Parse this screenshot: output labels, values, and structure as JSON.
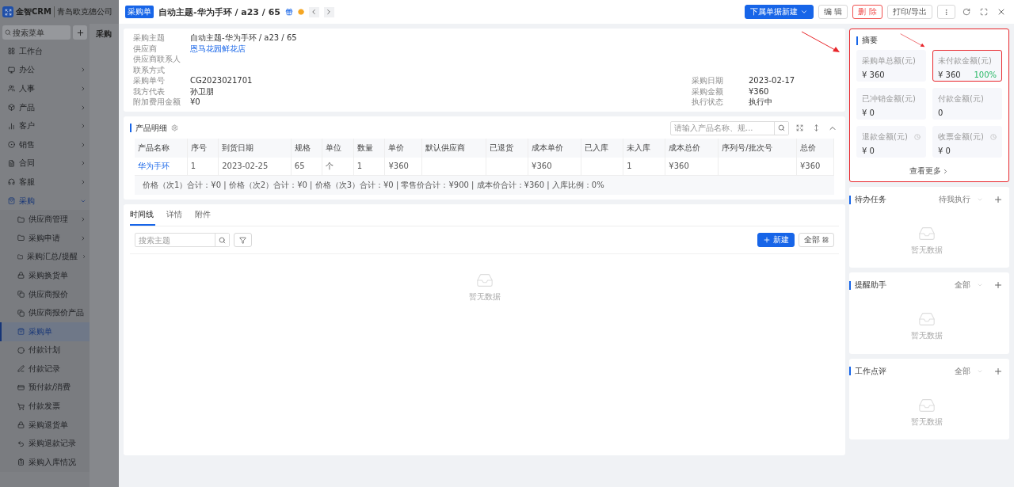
{
  "app": {
    "logo_text": "金智CRM",
    "company": "青岛欧克德公司",
    "search_placeholder": "搜索菜单",
    "behind_title": "采购",
    "menu": [
      {
        "label": "工作台",
        "kind": "page",
        "selected": false
      },
      {
        "label": "办公",
        "kind": "group",
        "expanded": false,
        "selected": false
      },
      {
        "label": "人事",
        "kind": "group",
        "expanded": false,
        "selected": false
      },
      {
        "label": "产品",
        "kind": "group",
        "expanded": false,
        "selected": false
      },
      {
        "label": "客户",
        "kind": "group",
        "expanded": false,
        "selected": false
      },
      {
        "label": "销售",
        "kind": "group",
        "expanded": false,
        "selected": false
      },
      {
        "label": "合同",
        "kind": "group",
        "expanded": false,
        "selected": false
      },
      {
        "label": "客服",
        "kind": "group",
        "expanded": false,
        "selected": false
      },
      {
        "label": "采购",
        "kind": "group",
        "expanded": true,
        "selected": false,
        "children": [
          {
            "label": "供应商管理",
            "kind": "group",
            "expanded": false,
            "selected": false
          },
          {
            "label": "采购申请",
            "kind": "group",
            "expanded": false,
            "selected": false
          },
          {
            "label": "采购汇总/提醒",
            "kind": "group",
            "expanded": false,
            "selected": false
          },
          {
            "label": "采购换货单",
            "kind": "page",
            "selected": false
          },
          {
            "label": "供应商报价",
            "kind": "page",
            "selected": false
          },
          {
            "label": "供应商报价产品",
            "kind": "page",
            "selected": false
          },
          {
            "label": "采购单",
            "kind": "page",
            "selected": true
          },
          {
            "label": "付款计划",
            "kind": "page",
            "selected": false
          },
          {
            "label": "付款记录",
            "kind": "page",
            "selected": false
          },
          {
            "label": "预付款/消费",
            "kind": "page",
            "selected": false
          },
          {
            "label": "付款发票",
            "kind": "page",
            "selected": false
          },
          {
            "label": "采购退货单",
            "kind": "page",
            "selected": false
          },
          {
            "label": "采购退款记录",
            "kind": "page",
            "selected": false
          },
          {
            "label": "采购入库情况",
            "kind": "page",
            "selected": false
          }
        ]
      }
    ]
  },
  "header": {
    "tag": "采购单",
    "title": "自动主题-华为手环 / a23 / 65",
    "buttons": [
      {
        "label": "下属单据新建",
        "kind": "primary"
      },
      {
        "label": "编 辑",
        "kind": "default"
      },
      {
        "label": "删 除",
        "kind": "danger"
      },
      {
        "label": "打印/导出",
        "kind": "default"
      }
    ]
  },
  "info": {
    "rows": [
      {
        "left": {
          "label": "采购主题",
          "value": "自动主题-华为手环 / a23 / 65",
          "kind": "text"
        }
      },
      {
        "left": {
          "label": "供应商",
          "value": "恩马花园鲜花店",
          "kind": "link"
        }
      },
      {
        "left": {
          "label": "供应商联系人"
        }
      },
      {
        "left": {
          "label": "联系方式"
        }
      },
      {
        "left": {
          "label": "采购单号",
          "value": "CG2023021701",
          "kind": "text"
        },
        "right": {
          "label": "采购日期",
          "value": "2023-02-17"
        }
      },
      {
        "left": {
          "label": "我方代表",
          "value": "孙卫朋",
          "kind": "text"
        },
        "right": {
          "label": "采购金额",
          "value": "¥360"
        }
      },
      {
        "left": {
          "label": "附加费用金额",
          "value": "¥0",
          "kind": "text"
        },
        "right": {
          "label": "执行状态",
          "value": "执行中"
        }
      }
    ]
  },
  "products": {
    "title": "产品明细",
    "search_placeholder": "请输入产品名称、规...",
    "columns": [
      "产品名称",
      "序号",
      "到货日期",
      "规格",
      "单位",
      "数量",
      "单价",
      "默认供应商",
      "已退货",
      "成本单价",
      "已入库",
      "未入库",
      "成本总价",
      "序列号/批次号",
      "总价"
    ],
    "rows": [
      [
        "华为手环",
        "1",
        "2023-02-25",
        "65",
        "个",
        "1",
        "¥360",
        "",
        "",
        "¥360",
        "",
        "1",
        "¥360",
        "",
        "¥360"
      ]
    ],
    "summary": "价格（次1）合计：¥0 | 价格（次2）合计：¥0 | 价格（次3）合计：¥0 | 零售价合计：¥900 | 成本价合计：¥360 | 入库比例：0%"
  },
  "timeline": {
    "tabs": [
      {
        "label": "时间线",
        "selected": true
      },
      {
        "label": "详情",
        "selected": false
      },
      {
        "label": "附件",
        "selected": false
      }
    ],
    "search_placeholder": "搜索主题",
    "new_button": "新建",
    "filter_button": "全部",
    "empty": "暂无数据"
  },
  "summary": {
    "title": "摘要",
    "highlighted": true,
    "more": "查看更多",
    "stats": [
      {
        "label": "采购单总额(元)",
        "value": "¥ 360",
        "highlighted": false
      },
      {
        "label": "未付款金额(元)",
        "value": "¥ 360",
        "badge": "100%",
        "highlighted": true
      },
      {
        "label": "已冲销金额(元)",
        "value": "¥ 0",
        "highlighted": false
      },
      {
        "label": "付款金额(元)",
        "value": "0",
        "highlighted": false
      },
      {
        "label": "退款金额(元)",
        "value": "¥ 0",
        "info": true,
        "highlighted": false
      },
      {
        "label": "收票金额(元)",
        "value": "¥ 0",
        "info": true,
        "highlighted": false
      }
    ]
  },
  "panels": [
    {
      "title": "待办任务",
      "filter": "待我执行",
      "empty": "暂无数据"
    },
    {
      "title": "提醒助手",
      "filter": "全部",
      "empty": "暂无数据"
    },
    {
      "title": "工作点评",
      "filter": "全部",
      "empty": "暂无数据"
    }
  ]
}
